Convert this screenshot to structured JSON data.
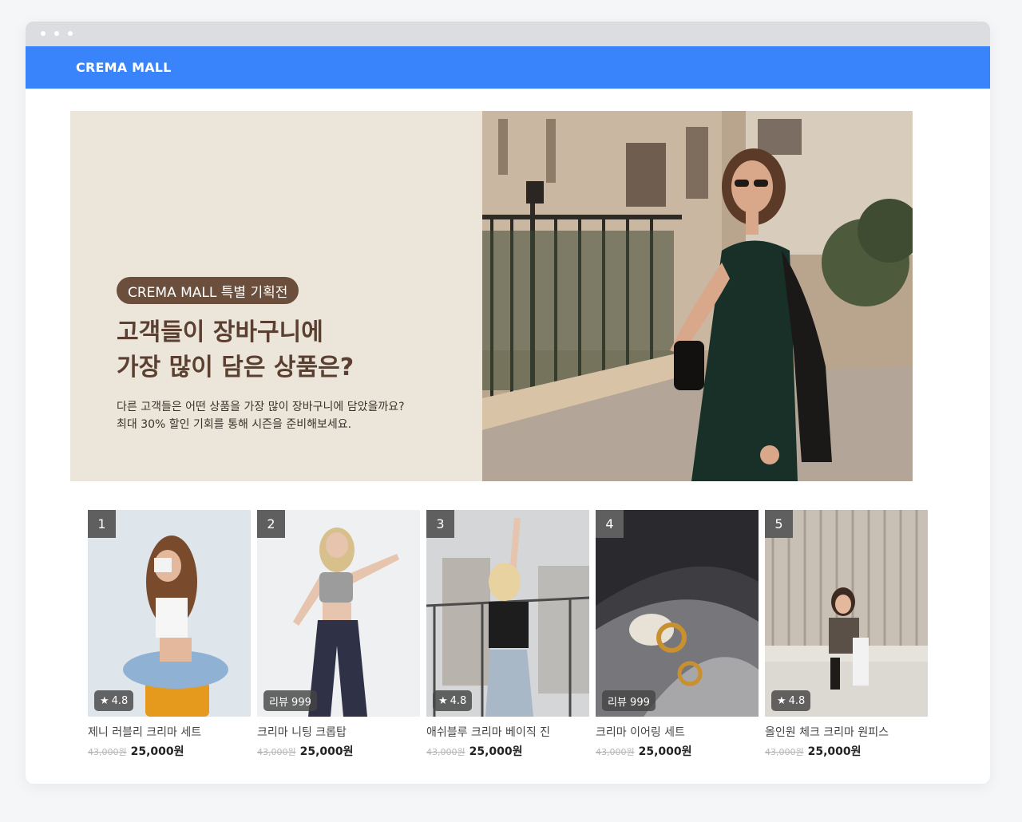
{
  "header": {
    "brand": "CREMA MALL"
  },
  "hero": {
    "badge": "CREMA MALL 특별 기획전",
    "title_line1": "고객들이 장바구니에",
    "title_line2": "가장 많이 담은 상품은?",
    "desc_line1": "다른 고객들은 어떤 상품을 가장 많이 장바구니에 담았을까요?",
    "desc_line2": "최대 30% 할인 기회를 통해 시즌을 준비해보세요."
  },
  "products": [
    {
      "rank": "1",
      "tag": "4.8",
      "tag_type": "rating",
      "name": "제니 러블리 크리마 세트",
      "original_price": "43,000원",
      "price": "25,000원"
    },
    {
      "rank": "2",
      "tag": "리뷰 999",
      "tag_type": "review",
      "name": "크리마 니팅 크롭탑",
      "original_price": "43,000원",
      "price": "25,000원"
    },
    {
      "rank": "3",
      "tag": "4.8",
      "tag_type": "rating",
      "name": "애쉬블루 크리마 베이직 진",
      "original_price": "43,000원",
      "price": "25,000원"
    },
    {
      "rank": "4",
      "tag": "리뷰 999",
      "tag_type": "review",
      "name": "크리마 이어링 세트",
      "original_price": "43,000원",
      "price": "25,000원"
    },
    {
      "rank": "5",
      "tag": "4.8",
      "tag_type": "rating",
      "name": "올인원 체크 크리마 원피스",
      "original_price": "43,000원",
      "price": "25,000원"
    }
  ],
  "colors": {
    "nav": "#3a84fb",
    "badge": "#6b4f3c",
    "hero_bg": "#ebe5da",
    "hero_title": "#5b4032"
  }
}
